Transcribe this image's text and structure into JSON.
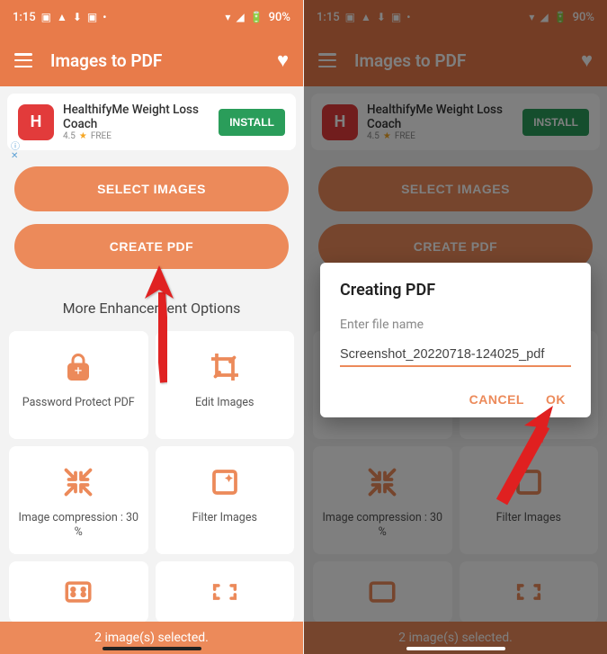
{
  "status": {
    "time": "1:15",
    "battery": "90%"
  },
  "appbar": {
    "title": "Images to PDF"
  },
  "ad": {
    "title": "HealthifyMe Weight Loss Coach",
    "rating": "4.5",
    "free": "FREE",
    "install": "INSTALL"
  },
  "buttons": {
    "select": "SELECT IMAGES",
    "create": "CREATE PDF"
  },
  "section": {
    "title": "More Enhancement Options"
  },
  "tiles": {
    "t0": "Password Protect PDF",
    "t1": "Edit Images",
    "t2": "Image compression : 30 %",
    "t3": "Filter Images"
  },
  "bottom": {
    "text": "2 image(s) selected."
  },
  "dialog": {
    "title": "Creating PDF",
    "label": "Enter file name",
    "value": "Screenshot_20220718-124025_pdf",
    "cancel": "CANCEL",
    "ok": "OK"
  }
}
